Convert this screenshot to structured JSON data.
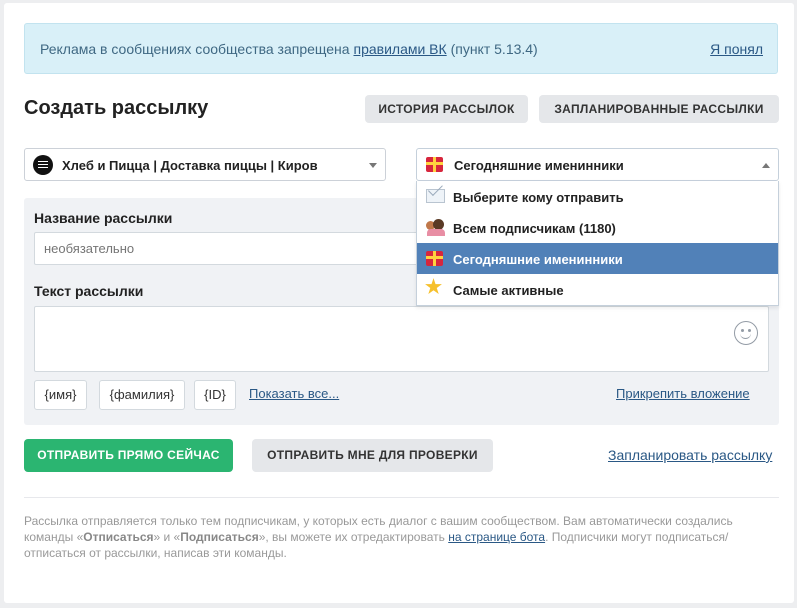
{
  "notice": {
    "text_before": "Реклама в сообщениях сообщества запрещена",
    "link": "правилами ВК",
    "text_after": "(пункт 5.13.4)",
    "dismiss": "Я понял"
  },
  "title": "Создать рассылку",
  "header_buttons": {
    "history": "ИСТОРИЯ РАССЫЛОК",
    "scheduled": "ЗАПЛАНИРОВАННЫЕ РАССЫЛКИ"
  },
  "community_select": {
    "value": "Хлеб и Пицца | Доставка пиццы | Киров"
  },
  "audience_select": {
    "value": "Сегодняшние именинники",
    "options": [
      {
        "label": "Выберите кому отправить",
        "icon": "envelope-icon"
      },
      {
        "label": "Всем подписчикам (1180)",
        "icon": "people-icon"
      },
      {
        "label": "Сегодняшние именинники",
        "icon": "gift-icon",
        "selected": true
      },
      {
        "label": "Самые активные",
        "icon": "star-icon"
      }
    ]
  },
  "form": {
    "name_label": "Название рассылки",
    "name_placeholder": "необязательно",
    "text_label": "Текст рассылки",
    "tags": [
      "{имя}",
      "{фамилия}",
      "{ID}"
    ],
    "show_all": "Показать все...",
    "attach": "Прикрепить вложение"
  },
  "actions": {
    "send_now": "ОТПРАВИТЬ ПРЯМО СЕЙЧАС",
    "send_test": "ОТПРАВИТЬ МНЕ ДЛЯ ПРОВЕРКИ",
    "schedule": "Запланировать рассылку"
  },
  "footer": {
    "part1": "Рассылка отправляется только тем подписчикам, у которых есть диалог с вашим сообществом. Вам автоматически создались команды «",
    "cmd1": "Отписаться",
    "part2": "» и «",
    "cmd2": "Подписаться",
    "part3": "», вы можете их отредактировать ",
    "link": "на странице бота",
    "part4": ". Подписчики могут подписаться/отписаться от рассылки, написав эти команды."
  }
}
